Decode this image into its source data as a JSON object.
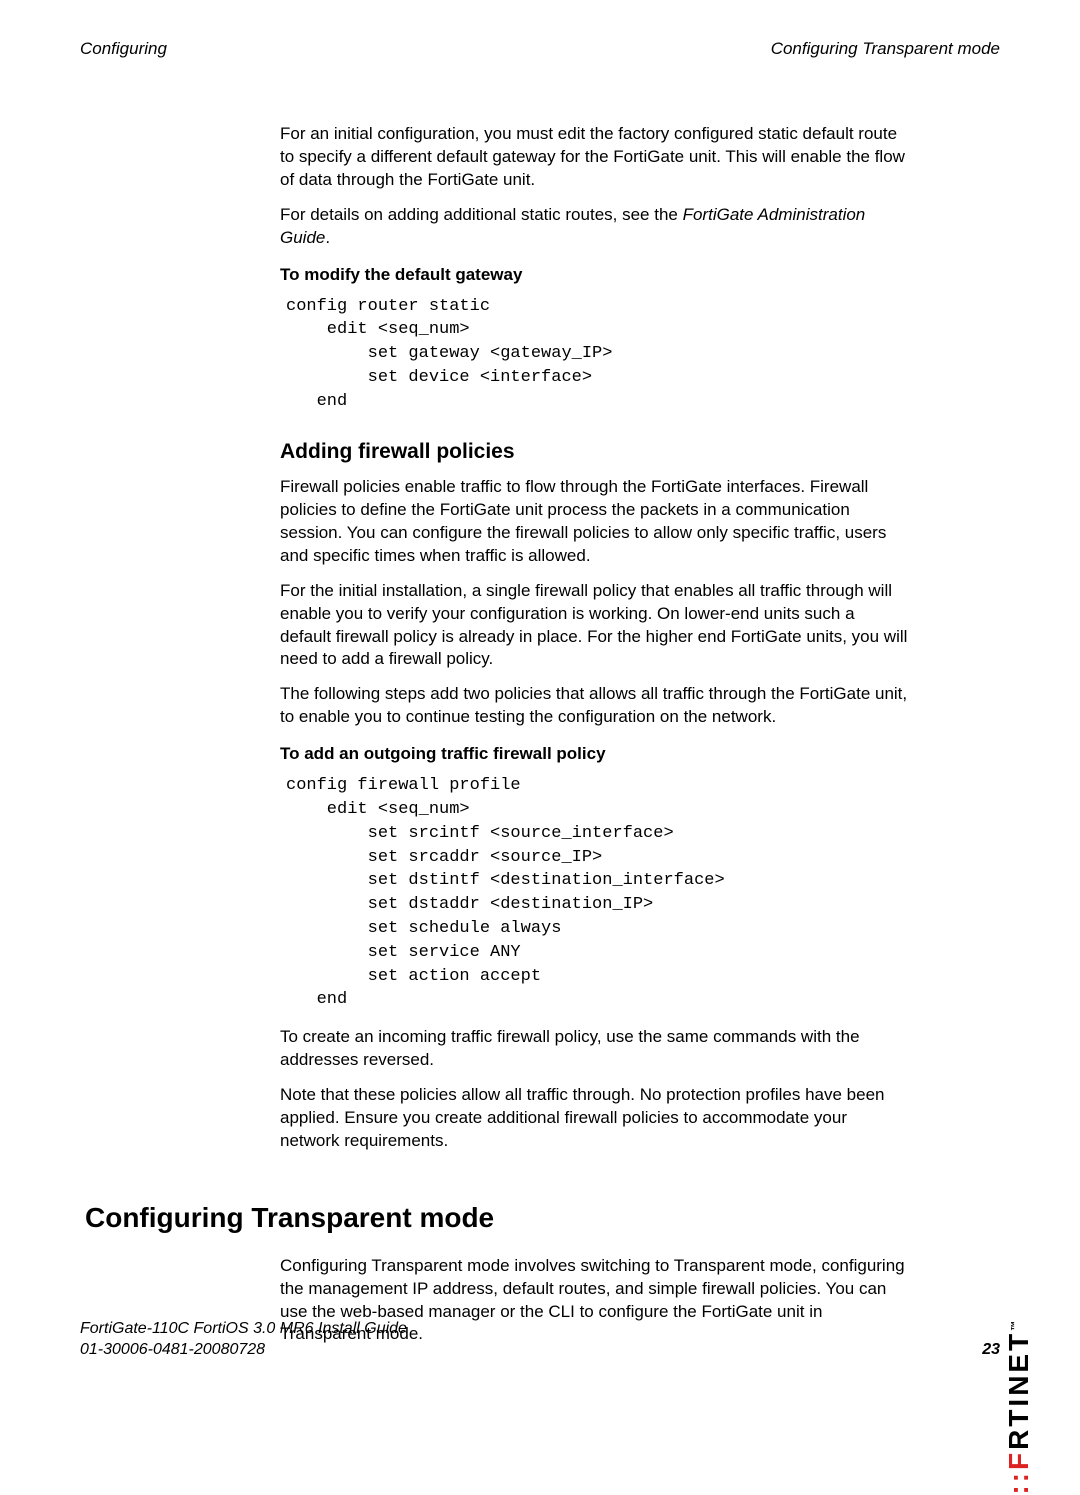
{
  "header": {
    "left": "Configuring",
    "right": "Configuring Transparent mode"
  },
  "body": {
    "p1": "For an initial configuration, you must edit the factory configured static default route to specify a different default gateway for the FortiGate unit. This will enable the flow of data through the FortiGate unit.",
    "p2_pre": "For details on adding additional static routes, see the ",
    "p2_em": "FortiGate Administration Guide",
    "p2_post": ".",
    "h_modify": "To modify the default gateway",
    "code1": "config router static\n    edit <seq_num>\n        set gateway <gateway_IP>\n        set device <interface>\n   end",
    "h_fw": "Adding firewall policies",
    "p3": "Firewall policies enable traffic to flow through the FortiGate interfaces. Firewall policies to define the FortiGate unit process the packets in a communication session. You can configure the firewall policies to allow only specific traffic, users and specific times when traffic is allowed.",
    "p4": "For the initial installation, a single firewall policy that enables all traffic through will enable you to verify your configuration is working. On lower-end units such a default firewall policy is already in place. For the higher end FortiGate units, you will need to add a firewall policy.",
    "p5": "The following steps add two policies that allows all traffic through the FortiGate unit, to enable you to continue testing the configuration on the network.",
    "h_add": "To add an outgoing traffic firewall policy",
    "code2": "config firewall profile\n    edit <seq_num>\n        set srcintf <source_interface>\n        set srcaddr <source_IP>\n        set dstintf <destination_interface>\n        set dstaddr <destination_IP>\n        set schedule always\n        set service ANY\n        set action accept\n   end",
    "p6": "To create an incoming traffic firewall policy, use the same commands with the addresses reversed.",
    "p7": "Note that these policies allow all traffic through. No protection profiles have been applied. Ensure you create additional firewall policies to accommodate your network requirements.",
    "h_transparent": "Configuring Transparent mode",
    "p8": "Configuring Transparent mode involves switching to Transparent mode, configuring the management IP address, default routes, and simple firewall policies. You can use the web-based manager or the CLI to configure the FortiGate unit in Transparent mode."
  },
  "footer": {
    "line1": "FortiGate-110C FortiOS 3.0 MR6 Install Guide",
    "line2": "01-30006-0481-20080728",
    "page": "23"
  },
  "brand": {
    "name_black": "RTINET",
    "name_red": "F",
    "tm": "™"
  }
}
